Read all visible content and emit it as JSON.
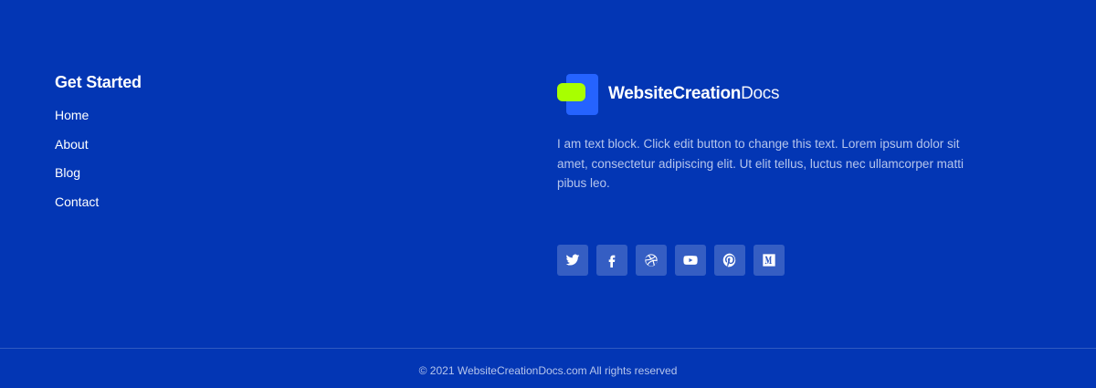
{
  "footer": {
    "menu_title": "Get Started",
    "menu_items": [
      {
        "label": "Home"
      },
      {
        "label": "About"
      },
      {
        "label": "Blog"
      },
      {
        "label": "Contact"
      }
    ],
    "brand": {
      "name_bold": "WebsiteCreation",
      "name_light": "Docs"
    },
    "description": "I am text block. Click edit button to change this text. Lorem ipsum dolor sit amet, consectetur adipiscing elit. Ut elit tellus, luctus nec ullamcorper matti pibus leo.",
    "social": [
      {
        "icon": "twitter-icon"
      },
      {
        "icon": "facebook-icon"
      },
      {
        "icon": "dribbble-icon"
      },
      {
        "icon": "youtube-icon"
      },
      {
        "icon": "pinterest-icon"
      },
      {
        "icon": "medium-icon"
      }
    ],
    "copyright": "© 2021 WebsiteCreationDocs.com All rights reserved"
  },
  "colors": {
    "background": "#0336b4",
    "logo_accent": "#a8ff00",
    "logo_primary": "#2563ff",
    "muted_text": "#b5c5ec"
  }
}
